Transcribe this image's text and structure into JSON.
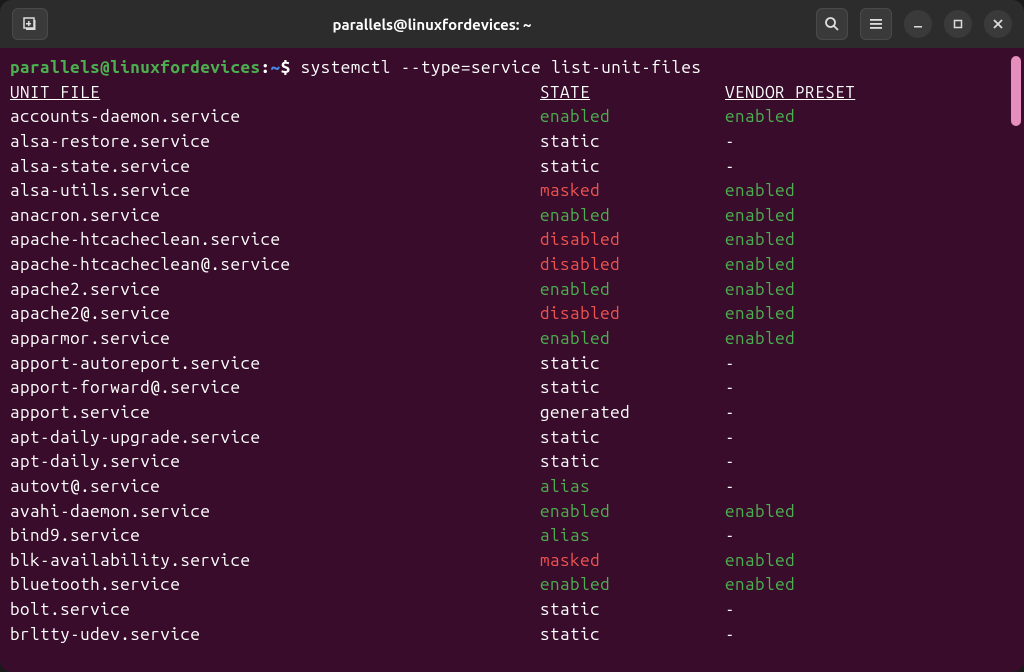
{
  "titlebar": {
    "title": "parallels@linuxfordevices: ~"
  },
  "prompt": {
    "user_host": "parallels@linuxfordevices",
    "path": "~",
    "command": "systemctl --type=service list-unit-files"
  },
  "headers": {
    "unit": "UNIT FILE",
    "state": "STATE",
    "preset": "VENDOR PRESET"
  },
  "rows": [
    {
      "unit": "accounts-daemon.service",
      "state": "enabled",
      "preset": "enabled"
    },
    {
      "unit": "alsa-restore.service",
      "state": "static",
      "preset": "-"
    },
    {
      "unit": "alsa-state.service",
      "state": "static",
      "preset": "-"
    },
    {
      "unit": "alsa-utils.service",
      "state": "masked",
      "preset": "enabled"
    },
    {
      "unit": "anacron.service",
      "state": "enabled",
      "preset": "enabled"
    },
    {
      "unit": "apache-htcacheclean.service",
      "state": "disabled",
      "preset": "enabled"
    },
    {
      "unit": "apache-htcacheclean@.service",
      "state": "disabled",
      "preset": "enabled"
    },
    {
      "unit": "apache2.service",
      "state": "enabled",
      "preset": "enabled"
    },
    {
      "unit": "apache2@.service",
      "state": "disabled",
      "preset": "enabled"
    },
    {
      "unit": "apparmor.service",
      "state": "enabled",
      "preset": "enabled"
    },
    {
      "unit": "apport-autoreport.service",
      "state": "static",
      "preset": "-"
    },
    {
      "unit": "apport-forward@.service",
      "state": "static",
      "preset": "-"
    },
    {
      "unit": "apport.service",
      "state": "generated",
      "preset": "-"
    },
    {
      "unit": "apt-daily-upgrade.service",
      "state": "static",
      "preset": "-"
    },
    {
      "unit": "apt-daily.service",
      "state": "static",
      "preset": "-"
    },
    {
      "unit": "autovt@.service",
      "state": "alias",
      "preset": "-"
    },
    {
      "unit": "avahi-daemon.service",
      "state": "enabled",
      "preset": "enabled"
    },
    {
      "unit": "bind9.service",
      "state": "alias",
      "preset": "-"
    },
    {
      "unit": "blk-availability.service",
      "state": "masked",
      "preset": "enabled"
    },
    {
      "unit": "bluetooth.service",
      "state": "enabled",
      "preset": "enabled"
    },
    {
      "unit": "bolt.service",
      "state": "static",
      "preset": "-"
    },
    {
      "unit": "brltty-udev.service",
      "state": "static",
      "preset": "-"
    }
  ]
}
